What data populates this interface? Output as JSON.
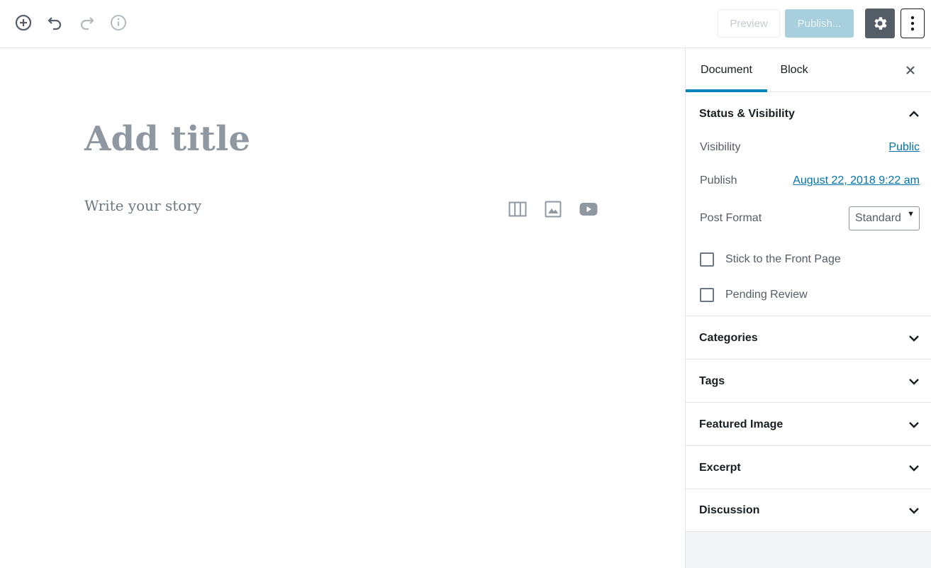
{
  "toolbar": {
    "icons": [
      "add-block-icon",
      "undo-icon",
      "redo-icon",
      "info-icon"
    ],
    "preview_label": "Preview",
    "publish_label": "Publish...",
    "settings_icon": "gear-icon",
    "more_icon": "vertical-ellipsis-icon"
  },
  "editor": {
    "title_placeholder": "Add title",
    "body_placeholder": "Write your story",
    "quick_inserters": [
      "columns-icon",
      "image-icon",
      "video-icon"
    ]
  },
  "sidebar": {
    "tabs": [
      {
        "label": "Document",
        "active": true
      },
      {
        "label": "Block",
        "active": false
      }
    ],
    "status_visibility": {
      "title": "Status & Visibility",
      "visibility_label": "Visibility",
      "visibility_value": "Public",
      "publish_label": "Publish",
      "publish_value": "August 22, 2018 9:22 am",
      "post_format_label": "Post Format",
      "post_format_value": "Standard",
      "stick_label": "Stick to the Front Page",
      "pending_label": "Pending Review"
    },
    "panels": [
      "Categories",
      "Tags",
      "Featured Image",
      "Excerpt",
      "Discussion"
    ]
  },
  "colors": {
    "accent": "#0085ba",
    "link": "#0073aa",
    "publish_disabled": "#a8d0dc",
    "settings_bg": "#555d66"
  }
}
